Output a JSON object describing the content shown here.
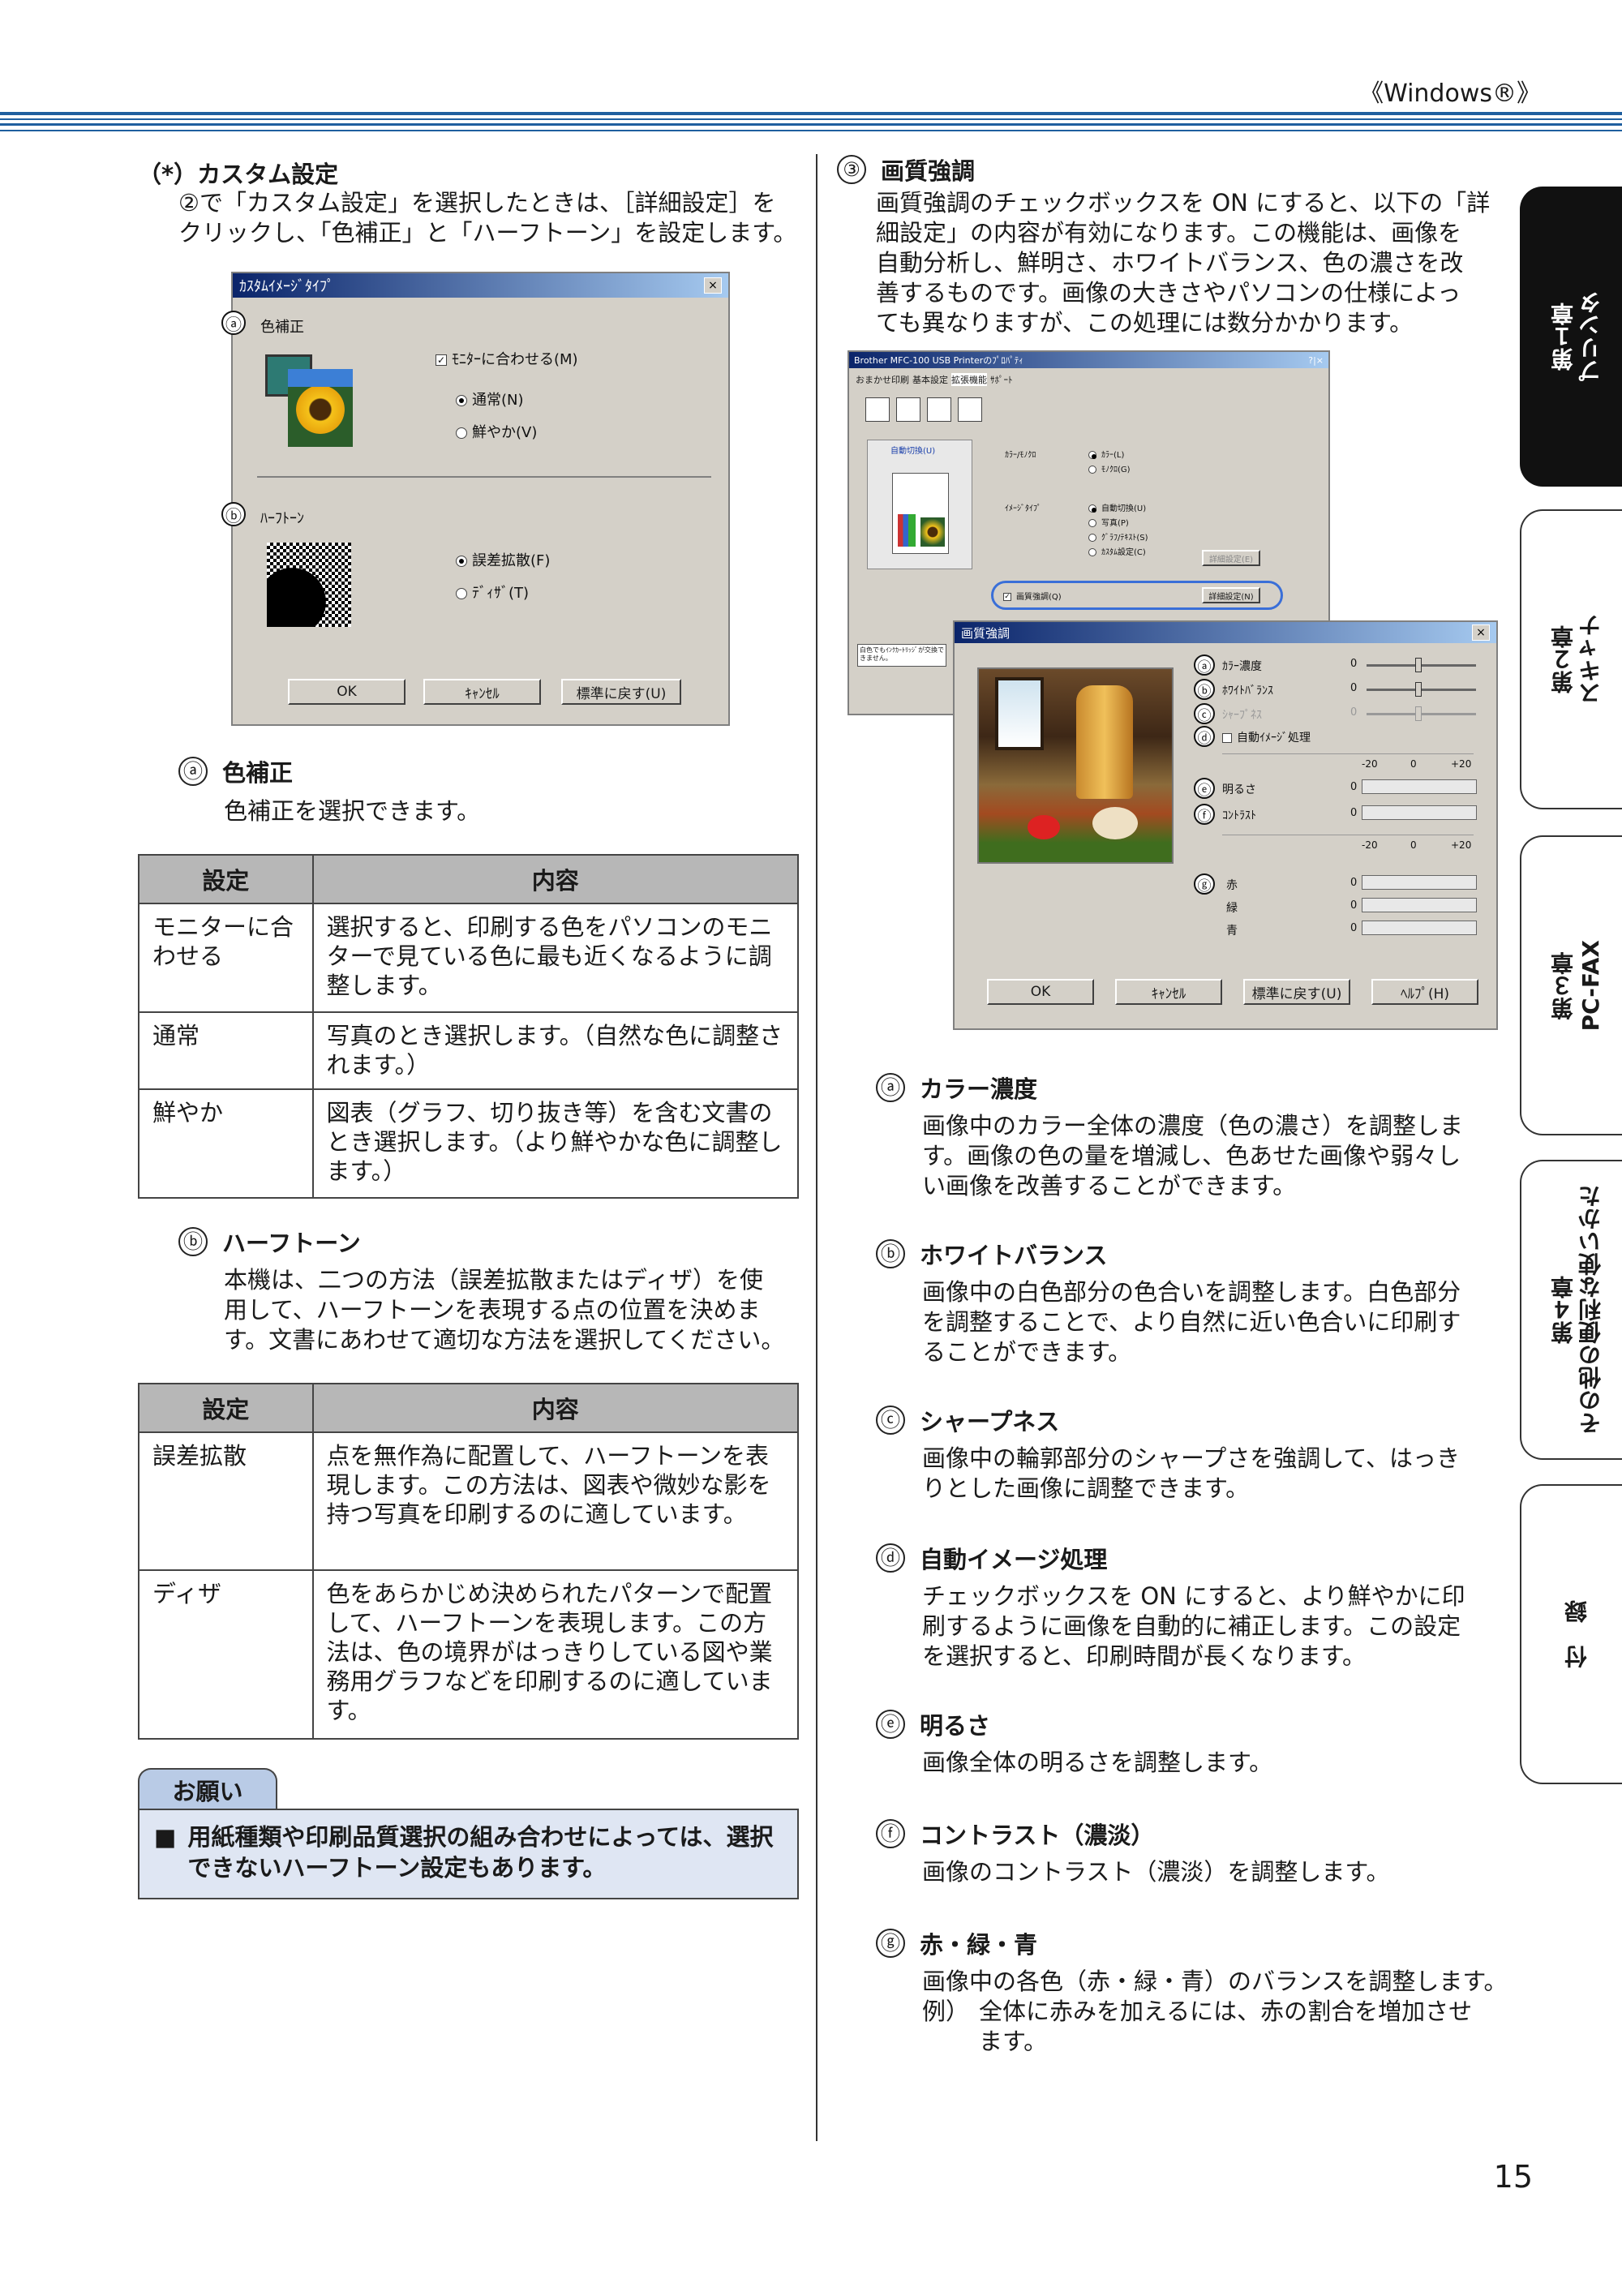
{
  "header": {
    "title": "《Windows®》"
  },
  "left": {
    "custom_heading": "（*）カスタム設定",
    "custom_text": [
      "②で「カスタム設定」を選択したときは、［詳細設定］を",
      "クリックし、「色補正」と「ハーフトーン」を設定します。"
    ],
    "dialog1": {
      "title": "ｶｽﾀﾑｲﾒｰｼﾞﾀｲﾌﾟ",
      "close": "×",
      "mark_a": "ⓐ",
      "mark_b": "ⓑ",
      "color_label": "色補正",
      "monitor_check": "ﾓﾆﾀｰに合わせる(M)",
      "normal_radio": "通常(N)",
      "vivid_radio": "鮮やか(V)",
      "halftone_label": "ﾊｰﾌﾄｰﾝ",
      "error_diffusion_radio": "誤差拡散(F)",
      "dither_radio": "ﾃﾞｨｻﾞ(T)",
      "ok": "OK",
      "cancel": "ｷｬﾝｾﾙ",
      "default": "標準に戻す(U)"
    },
    "a_heading": "色補正",
    "a_mark": "ⓐ",
    "a_text": "色補正を選択できます。",
    "table1": {
      "headers": [
        "設定",
        "内容"
      ],
      "rows": [
        {
          "setting": "モニターに合わせる",
          "content": "選択すると、印刷する色をパソコンのモニターで見ている色に最も近くなるように調整します。"
        },
        {
          "setting": "通常",
          "content": "写真のとき選択します。（自然な色に調整されます。）"
        },
        {
          "setting": "鮮やか",
          "content": "図表（グラフ、切り抜き等）を含む文書のとき選択します。（より鮮やかな色に調整します。）"
        }
      ]
    },
    "b_heading": "ハーフトーン",
    "b_mark": "ⓑ",
    "b_text": [
      "本機は、二つの方法（誤差拡散またはディザ）を使",
      "用して、ハーフトーンを表現する点の位置を決めま",
      "す。文書にあわせて適切な方法を選択してください。"
    ],
    "table2": {
      "headers": [
        "設定",
        "内容"
      ],
      "rows": [
        {
          "setting": "誤差拡散",
          "content": "点を無作為に配置して、ハーフトーンを表現します。この方法は、図表や微妙な影を持つ写真を印刷するのに適しています。"
        },
        {
          "setting": "ディザ",
          "content": "色をあらかじめ決められたパターンで配置して、ハーフトーンを表現します。この方法は、色の境界がはっきりしている図や業務用グラフなどを印刷するのに適しています。"
        }
      ]
    },
    "note": {
      "tab": "お願い",
      "bullet": "■",
      "text": "用紙種類や印刷品質選択の組み合わせによっては、選択できないハーフトーン設定もあります。"
    }
  },
  "right": {
    "q_mark": "③",
    "q_heading": "画質強調",
    "q_text": [
      "画質強調のチェックボックスを ON にすると、以下の「詳",
      "細設定」の内容が有効になります。この機能は、画像を",
      "自動分析し、鮮明さ、ホワイトバランス、色の濃さを改",
      "善するものです。画像の大きさやパソコンの仕様によっ",
      "ても異なりますが、この処理には数分かかります。"
    ],
    "props_dialog": {
      "title": "Brother MFC-100 USB Printerのﾌﾟﾛﾊﾟﾃｨ",
      "help_close": "?|×",
      "tabs": [
        "おまかせ印刷",
        "基本設定",
        "拡張機能",
        "ｻﾎﾟｰﾄ"
      ],
      "auto_switch": "自動切換(U)",
      "color_mono_label": "ｶﾗｰ/ﾓﾉｸﾛ",
      "color_radio": "ｶﾗｰ(L)",
      "mono_radio": "ﾓﾉｸﾛ(G)",
      "image_type_label": "ｲﾒｰｼﾞﾀｲﾌﾟ",
      "img_auto": "自動切換(U)",
      "img_photo": "写真(P)",
      "img_graph": "ｸﾞﾗﾌ/ﾃｷｽﾄ(S)",
      "img_custom": "ｶｽﾀﾑ設定(C)",
      "detail1": "詳細設定(E)",
      "enhance_check": "画質強調(Q)",
      "detail2": "詳細設定(N)",
      "warning": "白色でもｲﾝｸｶｰﾄﾘｯｼﾞが交換できません。"
    },
    "enhance_dialog": {
      "title": "画質強調",
      "close": "×",
      "marks": [
        "ⓐ",
        "ⓑ",
        "ⓒ",
        "ⓓ",
        "ⓔ",
        "ⓕ",
        "ⓖ"
      ],
      "color_density": "ｶﾗｰ濃度",
      "white_balance": "ﾎﾜｲﾄﾊﾞﾗﾝｽ",
      "sharpness": "ｼｬｰﾌﾟﾈｽ",
      "auto_image": "自動ｲﾒｰｼﾞ処理",
      "scale_min": "-20",
      "scale_mid": "0",
      "scale_max": "+20",
      "brightness": "明るさ",
      "contrast": "ｺﾝﾄﾗｽﾄ",
      "red": "赤",
      "green": "緑",
      "blue": "青",
      "zero": "0",
      "ok": "OK",
      "cancel": "ｷｬﾝｾﾙ",
      "default": "標準に戻す(U)",
      "help": "ﾍﾙﾌﾟ(H)"
    },
    "items": [
      {
        "mark": "ⓐ",
        "heading": "カラー濃度",
        "lines": [
          "画像中のカラー全体の濃度（色の濃さ）を調整しま",
          "す。画像の色の量を増減し、色あせた画像や弱々し",
          "い画像を改善することができます。"
        ]
      },
      {
        "mark": "ⓑ",
        "heading": "ホワイトバランス",
        "lines": [
          "画像中の白色部分の色合いを調整します。白色部分",
          "を調整することで、より自然に近い色合いに印刷す",
          "ることができます。"
        ]
      },
      {
        "mark": "ⓒ",
        "heading": "シャープネス",
        "lines": [
          "画像中の輪郭部分のシャープさを強調して、はっき",
          "りとした画像に調整できます。"
        ]
      },
      {
        "mark": "ⓓ",
        "heading": "自動イメージ処理",
        "lines": [
          "チェックボックスを ON にすると、より鮮やかに印",
          "刷するように画像を自動的に補正します。この設定",
          "を選択すると、印刷時間が長くなります。"
        ]
      },
      {
        "mark": "ⓔ",
        "heading": "明るさ",
        "lines": [
          "画像全体の明るさを調整します。"
        ]
      },
      {
        "mark": "ⓕ",
        "heading": "コントラスト（濃淡）",
        "lines": [
          "画像のコントラスト（濃淡）を調整します。"
        ]
      },
      {
        "mark": "ⓖ",
        "heading": "赤・緑・青",
        "lines": [
          "画像中の各色（赤・緑・青）のバランスを調整します。"
        ]
      }
    ],
    "example_label": "例）",
    "example_lines": [
      "全体に赤みを加えるには、赤の割合を増加させ",
      "ます。"
    ]
  },
  "side_tabs": [
    {
      "label": "第１章\nプリンタ",
      "active": true
    },
    {
      "label": "第２章\nスキャナ",
      "active": false
    },
    {
      "label": "第３章\nPC-FAX",
      "active": false
    },
    {
      "label": "第４章\nその他の便利な使いかた",
      "active": false
    },
    {
      "label": "付　録",
      "active": false
    }
  ],
  "page_number": "15"
}
